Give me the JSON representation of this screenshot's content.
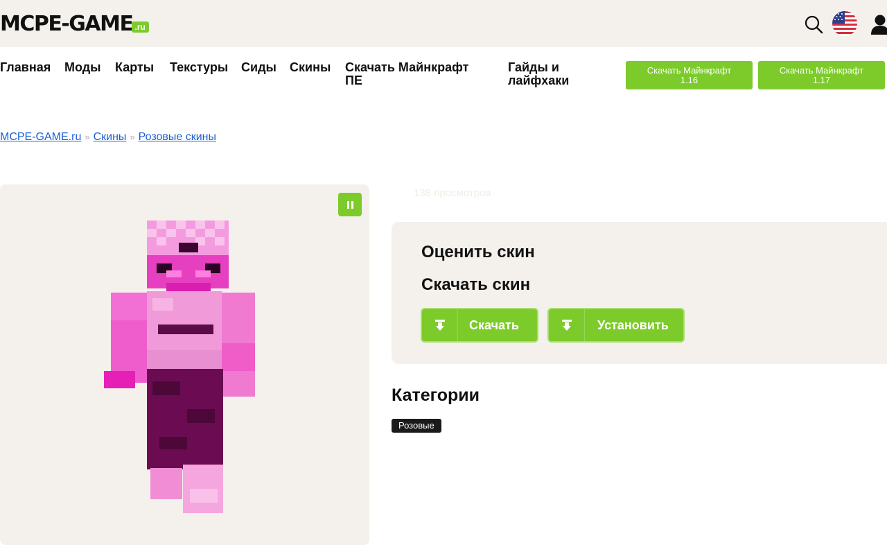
{
  "header": {
    "logo_main": "MCPE-GAME",
    "logo_tld": ".ru",
    "search_icon": "search-icon",
    "language_icon": "us-flag-icon",
    "user_icon": "user-icon"
  },
  "nav": {
    "items": [
      "Главная",
      "Моды",
      "Карты",
      "Текстуры",
      "Сиды",
      "Скины",
      "Скачать Майнкрафт ПЕ",
      "Гайды и лайфхаки"
    ],
    "download_buttons": [
      {
        "line1": "Скачать Майнкрафт",
        "line2": "1.16"
      },
      {
        "line1": "Скачать Майнкрафт",
        "line2": "1.17"
      }
    ]
  },
  "breadcrumb": {
    "items": [
      "MCPE-GAME.ru",
      "Скины",
      "Розовые скины"
    ],
    "separator": "»"
  },
  "preview": {
    "pause_icon": "pause-icon"
  },
  "details": {
    "views": "138 просмотров",
    "rate_title": "Оценить скин",
    "download_title": "Скачать скин",
    "download_button": "Скачать",
    "install_button": "Установить"
  },
  "categories": {
    "title": "Категории",
    "tags": [
      "Розовые"
    ]
  },
  "colors": {
    "accent": "#7ccb2b",
    "panel": "#f4f1ec",
    "link": "#1a5fd1"
  }
}
